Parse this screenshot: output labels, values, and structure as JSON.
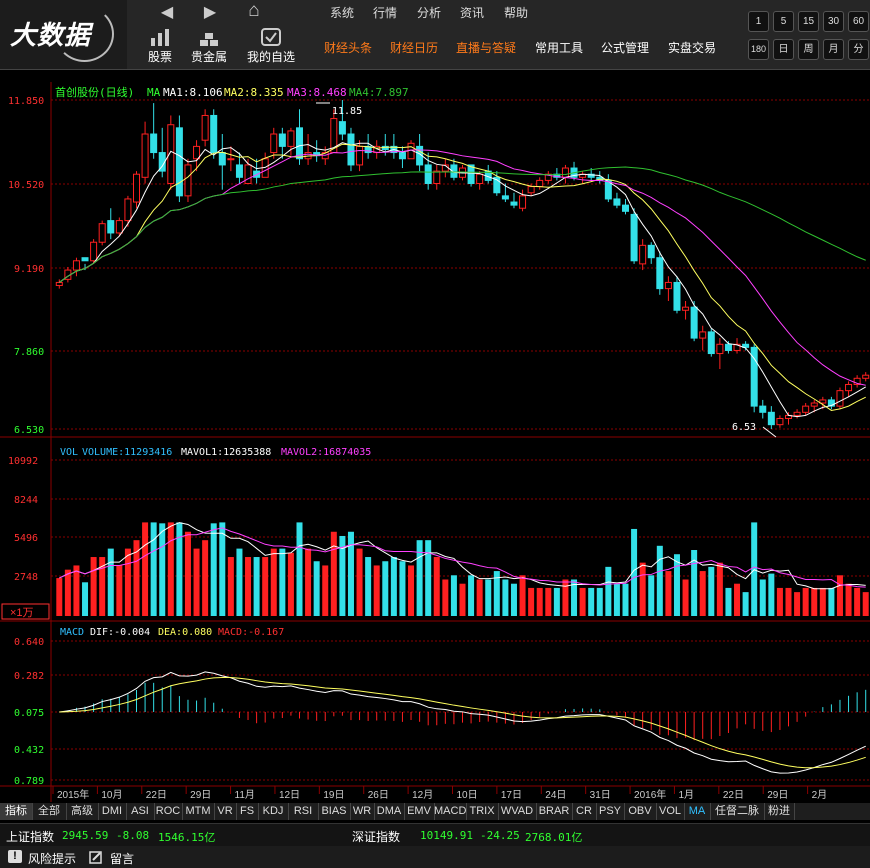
{
  "logo_text": "大数据",
  "nav": {
    "back": "◀",
    "forward": "▶",
    "home": "⌂"
  },
  "top_buttons": [
    {
      "label": "股票",
      "icon": "bar-chart-icon"
    },
    {
      "label": "贵金属",
      "icon": "gold-bars-icon"
    },
    {
      "label": "我的自选",
      "icon": "check-icon"
    }
  ],
  "menu_row1": [
    "系统",
    "行情",
    "分析",
    "资讯",
    "帮助"
  ],
  "menu_row2": [
    {
      "label": "财经头条",
      "color": "#ff7a1a"
    },
    {
      "label": "财经日历",
      "color": "#ff7a1a"
    },
    {
      "label": "直播与答疑",
      "color": "#ff7a1a"
    },
    {
      "label": "常用工具",
      "color": "#ffffff"
    },
    {
      "label": "公式管理",
      "color": "#ffffff"
    },
    {
      "label": "实盘交易",
      "color": "#ffffff"
    }
  ],
  "periods_row1": [
    "1",
    "5",
    "15",
    "30",
    "60"
  ],
  "periods_row2": [
    "180",
    "日",
    "周",
    "月",
    "分"
  ],
  "main_panel": {
    "title": "首创股份(日线)",
    "ma_label": "MA",
    "ma1": "MA1:8.106",
    "ma2": "MA2:8.335",
    "ma3": "MA3:8.468",
    "ma4": "MA4:7.897",
    "y_ticks": [
      "11.850",
      "10.520",
      "9.190",
      "7.860",
      "6.530"
    ],
    "high_label": "11.85",
    "low_label": "6.53"
  },
  "vol_panel": {
    "vol": "VOL",
    "volume": "VOLUME:11293416",
    "mavol1": "MAVOL1:12635388",
    "mavol2": "MAVOL2:16874035",
    "y_ticks": [
      "10992",
      "8244",
      "5496",
      "2748"
    ],
    "unit": "×1万"
  },
  "macd_panel": {
    "name": "MACD",
    "dif": "DIF:-0.004",
    "dea": "DEA:0.080",
    "macd": "MACD:-0.167",
    "y_ticks": [
      "0.640",
      "0.282",
      "0.075",
      "0.432",
      "0.789"
    ]
  },
  "x_labels": [
    "2015年",
    "10月",
    "22日",
    "29日",
    "11月",
    "12日",
    "19日",
    "26日",
    "12月",
    "10日",
    "17日",
    "24日",
    "31日",
    "2016年",
    "1月",
    "22日",
    "29日",
    "2月"
  ],
  "tabs": [
    "指标",
    "全部",
    "高级",
    "DMI",
    "ASI",
    "ROC",
    "MTM",
    "VR",
    "FS",
    "KDJ",
    "RSI",
    "BIAS",
    "WR",
    "DMA",
    "EMV",
    "MACD",
    "TRIX",
    "WVAD",
    "BRAR",
    "CR",
    "PSY",
    "OBV",
    "VOL",
    "MA",
    "任督二脉",
    "粉进"
  ],
  "index_bar": {
    "sh_name": "上证指数",
    "sh_value": "2945.59",
    "sh_change": "-8.08",
    "sh_amount": "1546.15亿",
    "sz_name": "深证指数",
    "sz_value": "10149.91",
    "sz_change": "-24.25",
    "sz_amount": "2768.01亿"
  },
  "status_bar": {
    "risk": "风险提示",
    "message": "留言"
  },
  "colors": {
    "up": "#ff2020",
    "down": "#33e0e8",
    "ma1": "#ffffff",
    "ma2": "#ffff60",
    "ma3": "#ff40ff",
    "ma4": "#30c030",
    "grid": "#8b0000",
    "label_green": "#30ff30",
    "label_red": "#ff3030"
  },
  "chart_data": {
    "type": "candlestick",
    "title": "首创股份(日线)",
    "y_range": [
      6.53,
      11.85
    ],
    "candles": [
      [
        8.85,
        8.95,
        8.8,
        8.9
      ],
      [
        8.95,
        9.15,
        8.9,
        9.1
      ],
      [
        9.1,
        9.3,
        9.0,
        9.25
      ],
      [
        9.3,
        9.2,
        9.1,
        9.25
      ],
      [
        9.25,
        9.6,
        9.2,
        9.55
      ],
      [
        9.55,
        9.9,
        9.5,
        9.85
      ],
      [
        9.9,
        10.1,
        9.6,
        9.7
      ],
      [
        9.7,
        9.95,
        9.65,
        9.9
      ],
      [
        9.9,
        10.3,
        9.8,
        10.25
      ],
      [
        10.2,
        10.7,
        10.1,
        10.65
      ],
      [
        10.6,
        11.5,
        10.5,
        11.3
      ],
      [
        11.3,
        11.8,
        10.9,
        11.0
      ],
      [
        11.0,
        11.4,
        10.6,
        10.7
      ],
      [
        10.5,
        11.6,
        10.4,
        11.45
      ],
      [
        11.4,
        11.6,
        10.2,
        10.3
      ],
      [
        10.3,
        10.9,
        10.2,
        10.8
      ],
      [
        10.9,
        11.2,
        10.7,
        11.1
      ],
      [
        11.2,
        11.7,
        11.1,
        11.6
      ],
      [
        11.6,
        11.7,
        10.9,
        11.0
      ],
      [
        11.0,
        11.3,
        10.4,
        10.8
      ],
      [
        10.9,
        11.1,
        10.7,
        10.9
      ],
      [
        10.8,
        11.0,
        10.5,
        10.6
      ],
      [
        10.5,
        10.9,
        10.5,
        10.8
      ],
      [
        10.7,
        10.9,
        10.5,
        10.6
      ],
      [
        10.6,
        11.0,
        10.6,
        10.9
      ],
      [
        11.0,
        11.4,
        10.9,
        11.3
      ],
      [
        11.3,
        11.4,
        10.9,
        11.1
      ],
      [
        11.1,
        11.4,
        10.95,
        11.35
      ],
      [
        11.4,
        11.7,
        10.8,
        10.9
      ],
      [
        10.9,
        11.3,
        10.8,
        11.0
      ],
      [
        11.0,
        11.2,
        10.85,
        10.95
      ],
      [
        10.9,
        11.1,
        10.8,
        11.0
      ],
      [
        11.0,
        11.7,
        11.0,
        11.55
      ],
      [
        11.5,
        11.85,
        11.2,
        11.3
      ],
      [
        11.3,
        11.4,
        10.7,
        10.8
      ],
      [
        10.8,
        11.2,
        10.7,
        11.1
      ],
      [
        11.1,
        11.3,
        10.9,
        11.0
      ],
      [
        11.0,
        11.2,
        10.9,
        11.1
      ],
      [
        11.1,
        11.3,
        10.95,
        11.05
      ],
      [
        11.1,
        11.3,
        10.9,
        11.0
      ],
      [
        11.0,
        11.1,
        10.75,
        10.9
      ],
      [
        10.9,
        11.2,
        10.9,
        11.15
      ],
      [
        11.1,
        11.3,
        10.7,
        10.8
      ],
      [
        10.8,
        11.0,
        10.4,
        10.5
      ],
      [
        10.5,
        10.8,
        10.4,
        10.7
      ],
      [
        10.7,
        10.9,
        10.6,
        10.8
      ],
      [
        10.8,
        10.9,
        10.55,
        10.6
      ],
      [
        10.6,
        10.8,
        10.55,
        10.75
      ],
      [
        10.8,
        10.8,
        10.45,
        10.5
      ],
      [
        10.5,
        10.7,
        10.4,
        10.65
      ],
      [
        10.7,
        10.8,
        10.5,
        10.55
      ],
      [
        10.6,
        10.7,
        10.3,
        10.35
      ],
      [
        10.3,
        10.5,
        10.2,
        10.25
      ],
      [
        10.2,
        10.35,
        10.1,
        10.15
      ],
      [
        10.1,
        10.4,
        10.05,
        10.3
      ],
      [
        10.35,
        10.5,
        10.3,
        10.45
      ],
      [
        10.45,
        10.6,
        10.4,
        10.55
      ],
      [
        10.55,
        10.7,
        10.5,
        10.65
      ],
      [
        10.65,
        10.75,
        10.55,
        10.6
      ],
      [
        10.6,
        10.8,
        10.5,
        10.75
      ],
      [
        10.75,
        10.85,
        10.55,
        10.6
      ],
      [
        10.6,
        10.7,
        10.5,
        10.65
      ],
      [
        10.65,
        10.75,
        10.55,
        10.6
      ],
      [
        10.6,
        10.7,
        10.5,
        10.55
      ],
      [
        10.55,
        10.65,
        10.2,
        10.25
      ],
      [
        10.25,
        10.35,
        10.1,
        10.15
      ],
      [
        10.15,
        10.25,
        10.0,
        10.05
      ],
      [
        10.0,
        10.1,
        9.2,
        9.25
      ],
      [
        9.2,
        9.6,
        9.1,
        9.5
      ],
      [
        9.5,
        9.55,
        9.2,
        9.3
      ],
      [
        9.3,
        9.4,
        8.7,
        8.8
      ],
      [
        8.8,
        9.0,
        8.6,
        8.9
      ],
      [
        8.9,
        9.0,
        8.4,
        8.45
      ],
      [
        8.45,
        8.6,
        8.3,
        8.5
      ],
      [
        8.5,
        8.6,
        7.95,
        8.0
      ],
      [
        8.0,
        8.2,
        7.8,
        8.1
      ],
      [
        8.1,
        8.15,
        7.7,
        7.75
      ],
      [
        7.75,
        8.0,
        7.5,
        7.9
      ],
      [
        7.9,
        7.95,
        7.75,
        7.8
      ],
      [
        7.8,
        8.0,
        7.75,
        7.9
      ],
      [
        7.9,
        7.95,
        7.8,
        7.85
      ],
      [
        7.85,
        7.9,
        6.8,
        6.9
      ],
      [
        6.9,
        7.0,
        6.7,
        6.8
      ],
      [
        6.8,
        6.9,
        6.53,
        6.6
      ],
      [
        6.6,
        6.75,
        6.55,
        6.7
      ],
      [
        6.7,
        6.8,
        6.6,
        6.75
      ],
      [
        6.75,
        6.85,
        6.7,
        6.8
      ],
      [
        6.8,
        6.95,
        6.75,
        6.9
      ],
      [
        6.9,
        7.0,
        6.8,
        6.95
      ],
      [
        6.95,
        7.05,
        6.85,
        7.0
      ],
      [
        7.0,
        7.05,
        6.85,
        6.9
      ],
      [
        6.9,
        7.2,
        6.85,
        7.15
      ],
      [
        7.15,
        7.3,
        7.05,
        7.25
      ],
      [
        7.25,
        7.4,
        7.2,
        7.35
      ],
      [
        7.35,
        7.45,
        7.3,
        7.4
      ]
    ]
  }
}
